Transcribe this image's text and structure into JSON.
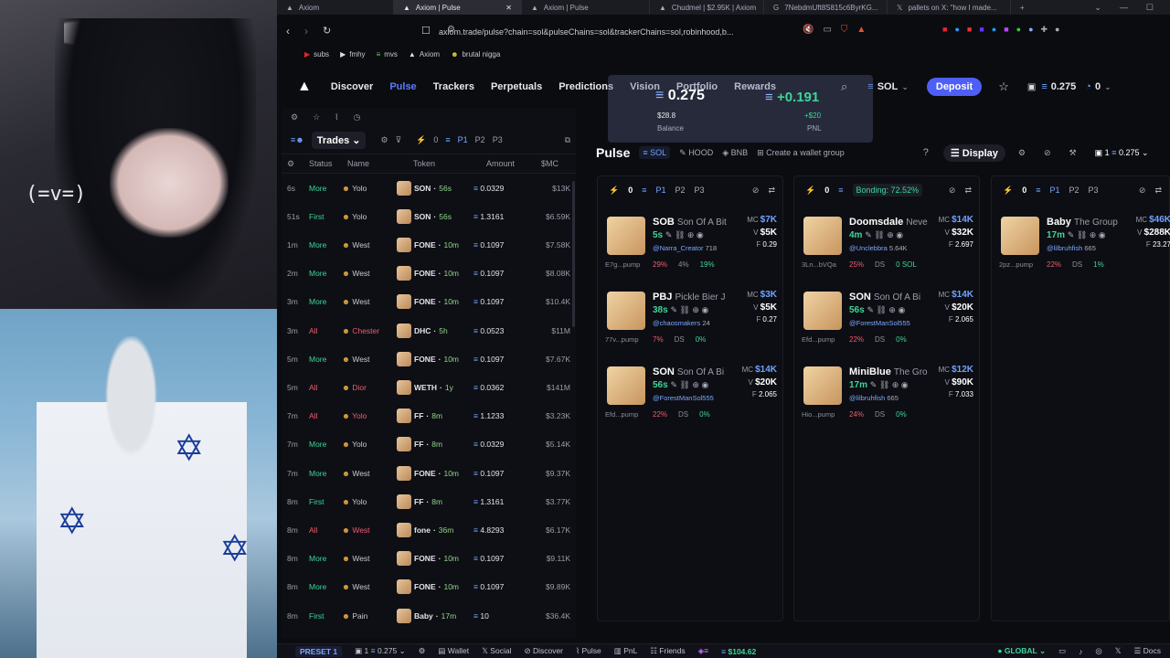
{
  "browser": {
    "tabs": [
      {
        "label": "Axiom",
        "active": false
      },
      {
        "label": "Axiom | Pulse",
        "active": true
      },
      {
        "label": "Axiom | Pulse",
        "active": false
      },
      {
        "label": "Chudmel | $2.95K | Axiom",
        "active": false
      },
      {
        "label": "7NebdmUft8S815c6ByrKG...",
        "active": false
      },
      {
        "label": "pallets on X: \"how I made...",
        "active": false
      }
    ],
    "url": "axiom.trade/pulse?chain=sol&pulseChains=sol&trackerChains=sol,robinhood,b...",
    "bookmarks": [
      "subs",
      "fmhy",
      "mvs",
      "Axiom",
      "brutal nigga"
    ]
  },
  "overlay": {
    "emote": "(=v=)"
  },
  "nav": {
    "items": [
      "Discover",
      "Pulse",
      "Trackers",
      "Perpetuals",
      "Predictions",
      "Vision",
      "Portfolio",
      "Rewards"
    ],
    "chain": "SOL",
    "deposit": "Deposit",
    "balance": "0.275",
    "wallet_count": "0"
  },
  "popup": {
    "balance": "0.275",
    "balance_usd": "$28.8",
    "balance_label": "Balance",
    "pnl": "+0.191",
    "pnl_usd": "+$20",
    "pnl_label": "PNL"
  },
  "trades_panel": {
    "tab": "Trades",
    "count": "0",
    "presets": [
      "P1",
      "P2",
      "P3"
    ],
    "columns": [
      "Status",
      "Name",
      "Token",
      "Amount",
      "$MC"
    ],
    "rows": [
      {
        "t": "6s",
        "type": "More",
        "name": "Yolo",
        "token": "SON",
        "age": "56s",
        "amount": "0.0329",
        "mc": "$13K",
        "kind": "buy"
      },
      {
        "t": "51s",
        "type": "First",
        "name": "Yolo",
        "token": "SON",
        "age": "56s",
        "amount": "1.3161",
        "mc": "$6.59K",
        "kind": "buy"
      },
      {
        "t": "1m",
        "type": "More",
        "name": "West",
        "token": "FONE",
        "age": "10m",
        "amount": "0.1097",
        "mc": "$7.58K",
        "kind": "buy"
      },
      {
        "t": "2m",
        "type": "More",
        "name": "West",
        "token": "FONE",
        "age": "10m",
        "amount": "0.1097",
        "mc": "$8.08K",
        "kind": "buy"
      },
      {
        "t": "3m",
        "type": "More",
        "name": "West",
        "token": "FONE",
        "age": "10m",
        "amount": "0.1097",
        "mc": "$10.4K",
        "kind": "buy"
      },
      {
        "t": "3m",
        "type": "All",
        "name": "Chester",
        "token": "DHC",
        "age": "5h",
        "amount": "0.0523",
        "mc": "$11M",
        "kind": "sell"
      },
      {
        "t": "5m",
        "type": "More",
        "name": "West",
        "token": "FONE",
        "age": "10m",
        "amount": "0.1097",
        "mc": "$7.67K",
        "kind": "buy"
      },
      {
        "t": "5m",
        "type": "All",
        "name": "Dior",
        "token": "WETH",
        "age": "1y",
        "amount": "0.0362",
        "mc": "$141M",
        "kind": "sell"
      },
      {
        "t": "7m",
        "type": "All",
        "name": "Yolo",
        "token": "FF",
        "age": "8m",
        "amount": "1.1233",
        "mc": "$3.23K",
        "kind": "sell"
      },
      {
        "t": "7m",
        "type": "More",
        "name": "Yolo",
        "token": "FF",
        "age": "8m",
        "amount": "0.0329",
        "mc": "$5.14K",
        "kind": "buy"
      },
      {
        "t": "7m",
        "type": "More",
        "name": "West",
        "token": "FONE",
        "age": "10m",
        "amount": "0.1097",
        "mc": "$9.37K",
        "kind": "buy"
      },
      {
        "t": "8m",
        "type": "First",
        "name": "Yolo",
        "token": "FF",
        "age": "8m",
        "amount": "1.3161",
        "mc": "$3.77K",
        "kind": "buy"
      },
      {
        "t": "8m",
        "type": "All",
        "name": "West",
        "token": "fone",
        "age": "36m",
        "amount": "4.8293",
        "mc": "$6.17K",
        "kind": "sell"
      },
      {
        "t": "8m",
        "type": "More",
        "name": "West",
        "token": "FONE",
        "age": "10m",
        "amount": "0.1097",
        "mc": "$9.11K",
        "kind": "buy"
      },
      {
        "t": "8m",
        "type": "More",
        "name": "West",
        "token": "FONE",
        "age": "10m",
        "amount": "0.1097",
        "mc": "$9.89K",
        "kind": "buy"
      },
      {
        "t": "8m",
        "type": "First",
        "name": "Pain",
        "token": "Baby",
        "age": "17m",
        "amount": "10",
        "mc": "$36.4K",
        "kind": "buy"
      }
    ]
  },
  "pulse": {
    "title": "Pulse",
    "filters": [
      "SOL",
      "HOOD",
      "BNB",
      "Create a wallet group"
    ],
    "display": "Display",
    "balance": "0.275",
    "wallet_count": "1",
    "columns": [
      {
        "count": "0",
        "presets": [
          "P1",
          "P2",
          "P3"
        ],
        "label": "",
        "cards": [
          {
            "ticker": "SOB",
            "name": "Son Of A Bit",
            "age": "5s",
            "handle": "@Narra_Creator",
            "holders": "718",
            "addr": "E7g...pump",
            "mc": "$7K",
            "vol": "$5K",
            "f": "0.29",
            "s1": "29%",
            "s2": "4%",
            "s3": "19%"
          },
          {
            "ticker": "PBJ",
            "name": "Pickle Bier J",
            "age": "38s",
            "handle": "@chaosmakers",
            "holders": "24",
            "addr": "77v...pump",
            "mc": "$3K",
            "vol": "$5K",
            "f": "0.27",
            "s1": "7%",
            "s2": "DS",
            "s3": "0%"
          },
          {
            "ticker": "SON",
            "name": "Son Of A Bi",
            "age": "56s",
            "handle": "@ForestManSol555",
            "holders": "",
            "addr": "Efd...pump",
            "mc": "$14K",
            "vol": "$20K",
            "f": "2.065",
            "s1": "22%",
            "s2": "DS",
            "s3": "0%"
          }
        ]
      },
      {
        "count": "0",
        "presets": [],
        "label": "Bonding: 72.52%",
        "cards": [
          {
            "ticker": "Doomsdale",
            "name": "Neve",
            "age": "4m",
            "handle": "@Unclebbra",
            "holders": "5.64K",
            "addr": "3Ln...bVQa",
            "mc": "$14K",
            "vol": "$32K",
            "f": "2.697",
            "s1": "25%",
            "s2": "DS",
            "s3": "0 SOL"
          },
          {
            "ticker": "SON",
            "name": "Son Of A Bi",
            "age": "56s",
            "handle": "@ForestManSol555",
            "holders": "",
            "addr": "Efd...pump",
            "mc": "$14K",
            "vol": "$20K",
            "f": "2.065",
            "s1": "22%",
            "s2": "DS",
            "s3": "0%"
          },
          {
            "ticker": "MiniBlue",
            "name": "The Gro",
            "age": "17m",
            "handle": "@lilbruhfish",
            "holders": "665",
            "addr": "Hio...pump",
            "mc": "$12K",
            "vol": "$90K",
            "f": "7.033",
            "s1": "24%",
            "s2": "DS",
            "s3": "0%"
          }
        ]
      },
      {
        "count": "0",
        "presets": [
          "P1",
          "P2",
          "P3"
        ],
        "label": "",
        "cards": [
          {
            "ticker": "Baby",
            "name": "The Group",
            "age": "17m",
            "handle": "@lilbruhfish",
            "holders": "665",
            "addr": "2pz...pump",
            "mc": "$46K",
            "vol": "$288K",
            "f": "23.27",
            "s1": "22%",
            "s2": "DS",
            "s3": "1%"
          }
        ]
      }
    ]
  },
  "bottombar": {
    "preset": "PRESET 1",
    "wallets": "1",
    "balance": "0.275",
    "links": [
      "Wallet",
      "Social",
      "Discover",
      "Pulse",
      "PnL",
      "Friends"
    ],
    "sol_price": "$104.62",
    "region": "GLOBAL",
    "docs": "Docs"
  },
  "colors": {
    "accent": "#5b7cfa",
    "deposit": "#4e5ff6",
    "buy": "#3ed598",
    "sell": "#f15a6e",
    "mc": "#6fa2ff"
  }
}
